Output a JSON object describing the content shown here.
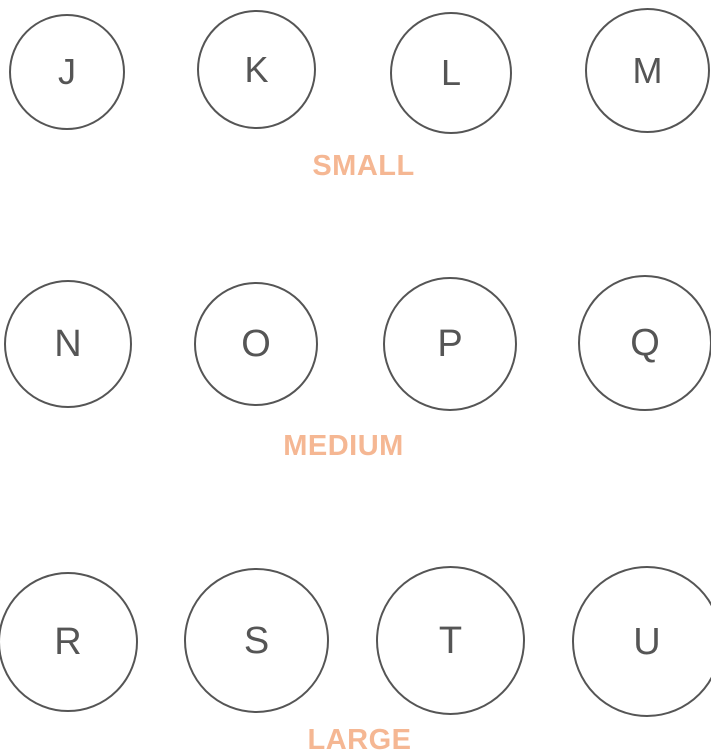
{
  "accent": "#f5b793",
  "groups": {
    "small": {
      "label": "SMALL",
      "buttons": [
        "J",
        "K",
        "L",
        "M"
      ]
    },
    "medium": {
      "label": "MEDIUM",
      "buttons": [
        "N",
        "O",
        "P",
        "Q"
      ]
    },
    "large": {
      "label": "LARGE",
      "buttons": [
        "R",
        "S",
        "T",
        "U"
      ]
    }
  }
}
